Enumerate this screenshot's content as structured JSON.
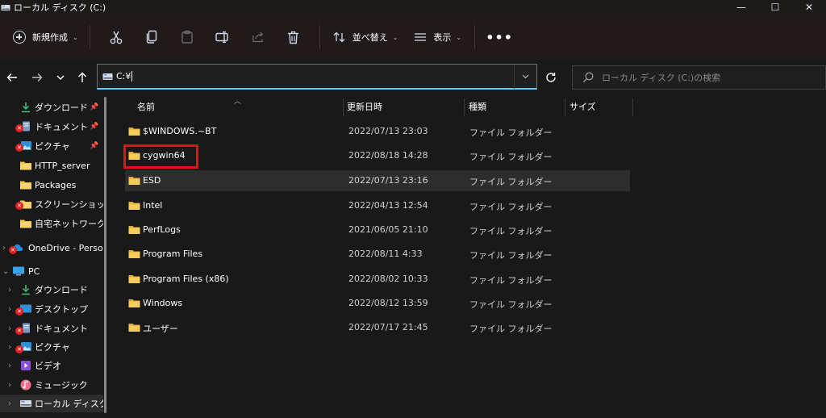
{
  "window": {
    "title": "ローカル ディスク (C:)",
    "controls": {
      "minimize": "—",
      "maximize": "☐",
      "close": "✕"
    }
  },
  "toolbar": {
    "new_label": "新規作成",
    "sort_label": "並べ替え",
    "view_label": "表示",
    "more_label": "•••",
    "icons": [
      "cut-icon",
      "copy-icon",
      "paste-icon",
      "rename-icon",
      "share-icon",
      "delete-icon"
    ]
  },
  "address": {
    "path": "C:¥",
    "search_placeholder": "ローカル ディスク (C:)の検索"
  },
  "sidebar": {
    "quick_access": [
      {
        "label": "ダウンロード",
        "icon": "download-icon",
        "pinned": true,
        "error": false
      },
      {
        "label": "ドキュメント",
        "icon": "document-icon",
        "pinned": true,
        "error": true
      },
      {
        "label": "ピクチャ",
        "icon": "pictures-icon",
        "pinned": true,
        "error": true
      },
      {
        "label": "HTTP_server",
        "icon": "folder-icon",
        "pinned": false,
        "error": false
      },
      {
        "label": "Packages",
        "icon": "folder-icon",
        "pinned": false,
        "error": false
      },
      {
        "label": "スクリーンショット",
        "icon": "folder-icon",
        "pinned": false,
        "error": true
      },
      {
        "label": "自宅ネットワーク",
        "icon": "folder-icon",
        "pinned": false,
        "error": false
      }
    ],
    "onedrive": {
      "label": "OneDrive - Persor",
      "icon": "cloud-icon"
    },
    "pc": {
      "label": "PC",
      "icon": "monitor-icon"
    },
    "pc_items": [
      {
        "label": "ダウンロード",
        "icon": "download-icon",
        "error": false
      },
      {
        "label": "デスクトップ",
        "icon": "desktop-icon",
        "error": true
      },
      {
        "label": "ドキュメント",
        "icon": "document-icon",
        "error": true
      },
      {
        "label": "ピクチャ",
        "icon": "pictures-icon",
        "error": true
      },
      {
        "label": "ビデオ",
        "icon": "video-icon",
        "error": false
      },
      {
        "label": "ミュージック",
        "icon": "music-icon",
        "error": false
      },
      {
        "label": "ローカル ディスク (C",
        "icon": "drive-icon",
        "error": false,
        "selected": true
      }
    ]
  },
  "columns": {
    "name": "名前",
    "modified": "更新日時",
    "type": "種類",
    "size": "サイズ"
  },
  "files": [
    {
      "name": "$WINDOWS.~BT",
      "modified": "2022/07/13 23:03",
      "type": "ファイル フォルダー"
    },
    {
      "name": "cygwin64",
      "modified": "2022/08/18 14:28",
      "type": "ファイル フォルダー",
      "annotated": true
    },
    {
      "name": "ESD",
      "modified": "2022/07/13 23:16",
      "type": "ファイル フォルダー",
      "hover": true
    },
    {
      "name": "Intel",
      "modified": "2022/04/13 12:54",
      "type": "ファイル フォルダー"
    },
    {
      "name": "PerfLogs",
      "modified": "2021/06/05 21:10",
      "type": "ファイル フォルダー"
    },
    {
      "name": "Program Files",
      "modified": "2022/08/11 4:33",
      "type": "ファイル フォルダー"
    },
    {
      "name": "Program Files (x86)",
      "modified": "2022/08/02 10:33",
      "type": "ファイル フォルダー"
    },
    {
      "name": "Windows",
      "modified": "2022/08/12 13:59",
      "type": "ファイル フォルダー"
    },
    {
      "name": "ユーザー",
      "modified": "2022/07/17 21:45",
      "type": "ファイル フォルダー"
    }
  ],
  "colors": {
    "background": "#191919",
    "folder": "#f2c14e",
    "accent": "#60cdff",
    "annotation": "#e0141e"
  }
}
